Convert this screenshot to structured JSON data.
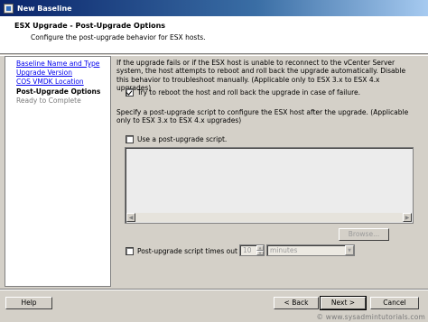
{
  "window": {
    "title": "New Baseline"
  },
  "header": {
    "title": "ESX Upgrade - Post-Upgrade Options",
    "subtitle": "Configure the post-upgrade behavior for ESX hosts."
  },
  "nav": {
    "items": [
      {
        "label": "Baseline Name and Type",
        "state": "link"
      },
      {
        "label": "Upgrade Version",
        "state": "link"
      },
      {
        "label": "COS VMDK Location",
        "state": "link"
      },
      {
        "label": "Post-Upgrade Options",
        "state": "current"
      },
      {
        "label": "Ready to Complete",
        "state": "upcoming"
      }
    ]
  },
  "content": {
    "intro_text": "If the upgrade fails or if the ESX host is unable to reconnect to the vCenter Server system, the host attempts to reboot and roll back the upgrade automatically. Disable this behavior to troubleshoot manually. (Applicable only to ESX 3.x to ESX 4.x upgrades)",
    "rollback_checkbox": {
      "label": "Try to reboot the host and roll back the upgrade in case of failure.",
      "checked": true
    },
    "script_text": "Specify a post-upgrade script to configure the ESX host after the upgrade. (Applicable only to ESX 3.x to ESX 4.x upgrades)",
    "use_script_checkbox": {
      "label": "Use a post-upgrade script.",
      "checked": false
    },
    "script_textarea": {
      "value": ""
    },
    "browse_label": "Browse...",
    "timeout_checkbox": {
      "label": "Post-upgrade script times out after:",
      "checked": false
    },
    "timeout_value": "10",
    "timeout_unit": "minutes"
  },
  "buttons": {
    "help": "Help",
    "back": "< Back",
    "next": "Next >",
    "cancel": "Cancel"
  },
  "watermark": "© www.sysadmintutorials.com"
}
